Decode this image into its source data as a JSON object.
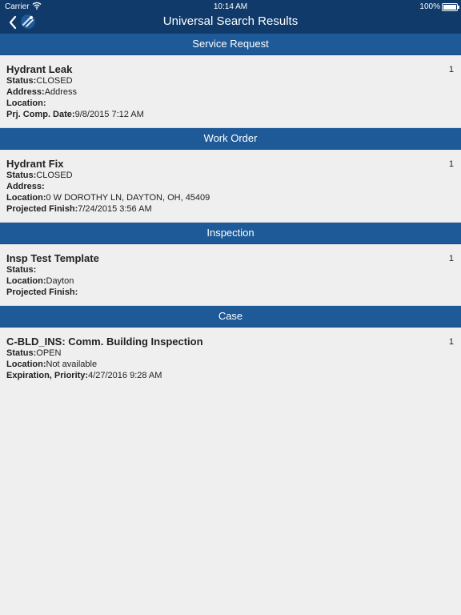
{
  "status_bar": {
    "carrier": "Carrier",
    "time": "10:14 AM",
    "battery": "100%"
  },
  "nav": {
    "title": "Universal Search Results",
    "back_icon": "chevron-left-icon",
    "app_icon": "app-logo-icon"
  },
  "sections": [
    {
      "header": "Service Request",
      "item": {
        "name": "Hydrant Leak",
        "count": "1",
        "fields": [
          {
            "label": "Status:",
            "value": "CLOSED"
          },
          {
            "label": "Address:",
            "value": "Address"
          },
          {
            "label": "Location:",
            "value": ""
          },
          {
            "label": "Prj. Comp. Date:",
            "value": "9/8/2015 7:12 AM"
          }
        ]
      }
    },
    {
      "header": "Work Order",
      "item": {
        "name": "Hydrant Fix",
        "count": "1",
        "fields": [
          {
            "label": "Status:",
            "value": "CLOSED"
          },
          {
            "label": "Address:",
            "value": ""
          },
          {
            "label": "Location:",
            "value": "0 W DOROTHY LN, DAYTON, OH, 45409"
          },
          {
            "label": "Projected Finish:",
            "value": "7/24/2015 3:56 AM"
          }
        ]
      }
    },
    {
      "header": "Inspection",
      "item": {
        "name": "Insp Test Template",
        "count": "1",
        "fields": [
          {
            "label": "Status:",
            "value": ""
          },
          {
            "label": "Location:",
            "value": "Dayton"
          },
          {
            "label": "Projected Finish:",
            "value": ""
          }
        ]
      }
    },
    {
      "header": "Case",
      "item": {
        "name": "C-BLD_INS: Comm. Building Inspection",
        "count": "1",
        "fields": [
          {
            "label": "Status:",
            "value": "OPEN"
          },
          {
            "label": "Location:",
            "value": "Not available"
          },
          {
            "label": "Expiration, Priority:",
            "value": "4/27/2016 9:28 AM"
          }
        ]
      }
    }
  ],
  "colors": {
    "nav_bg": "#0f3a6a",
    "section_header_bg": "#1f5a98",
    "background": "#efefef"
  }
}
